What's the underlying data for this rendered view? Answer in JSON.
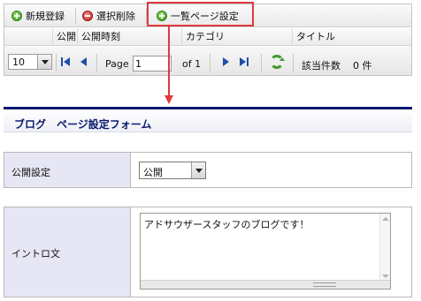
{
  "toolbar": {
    "add_label": "新規登録",
    "delete_label": "選択削除",
    "page_settings_label": "一覧ページ設定"
  },
  "columns": [
    "公開",
    "公開時刻",
    "カテゴリ",
    "タイトル"
  ],
  "pager": {
    "page_size": "10",
    "page_label": "Page",
    "page_value": "1",
    "of_label": "of 1",
    "count_label": "該当件数",
    "count_value": "0 件"
  },
  "form": {
    "title": "ブログ　ページ設定フォーム",
    "publish_label": "公開設定",
    "publish_value": "公開",
    "intro_label": "イントロ文",
    "intro_text": "アドサウザースタッフのブログです！"
  },
  "colors": {
    "highlight": "#e0393e",
    "title_bar": "#0c1a6e",
    "label_bg": "#e6e6f5",
    "add_icon": "#3a9a1e",
    "delete_icon": "#c41e1e",
    "nav_icon": "#1e4fa8"
  },
  "icons": {
    "add": "add-circle-icon",
    "delete": "delete-circle-icon",
    "settings": "add-circle-icon",
    "first": "first-page-icon",
    "prev": "prev-page-icon",
    "next": "next-page-icon",
    "last": "last-page-icon",
    "refresh": "refresh-icon"
  }
}
